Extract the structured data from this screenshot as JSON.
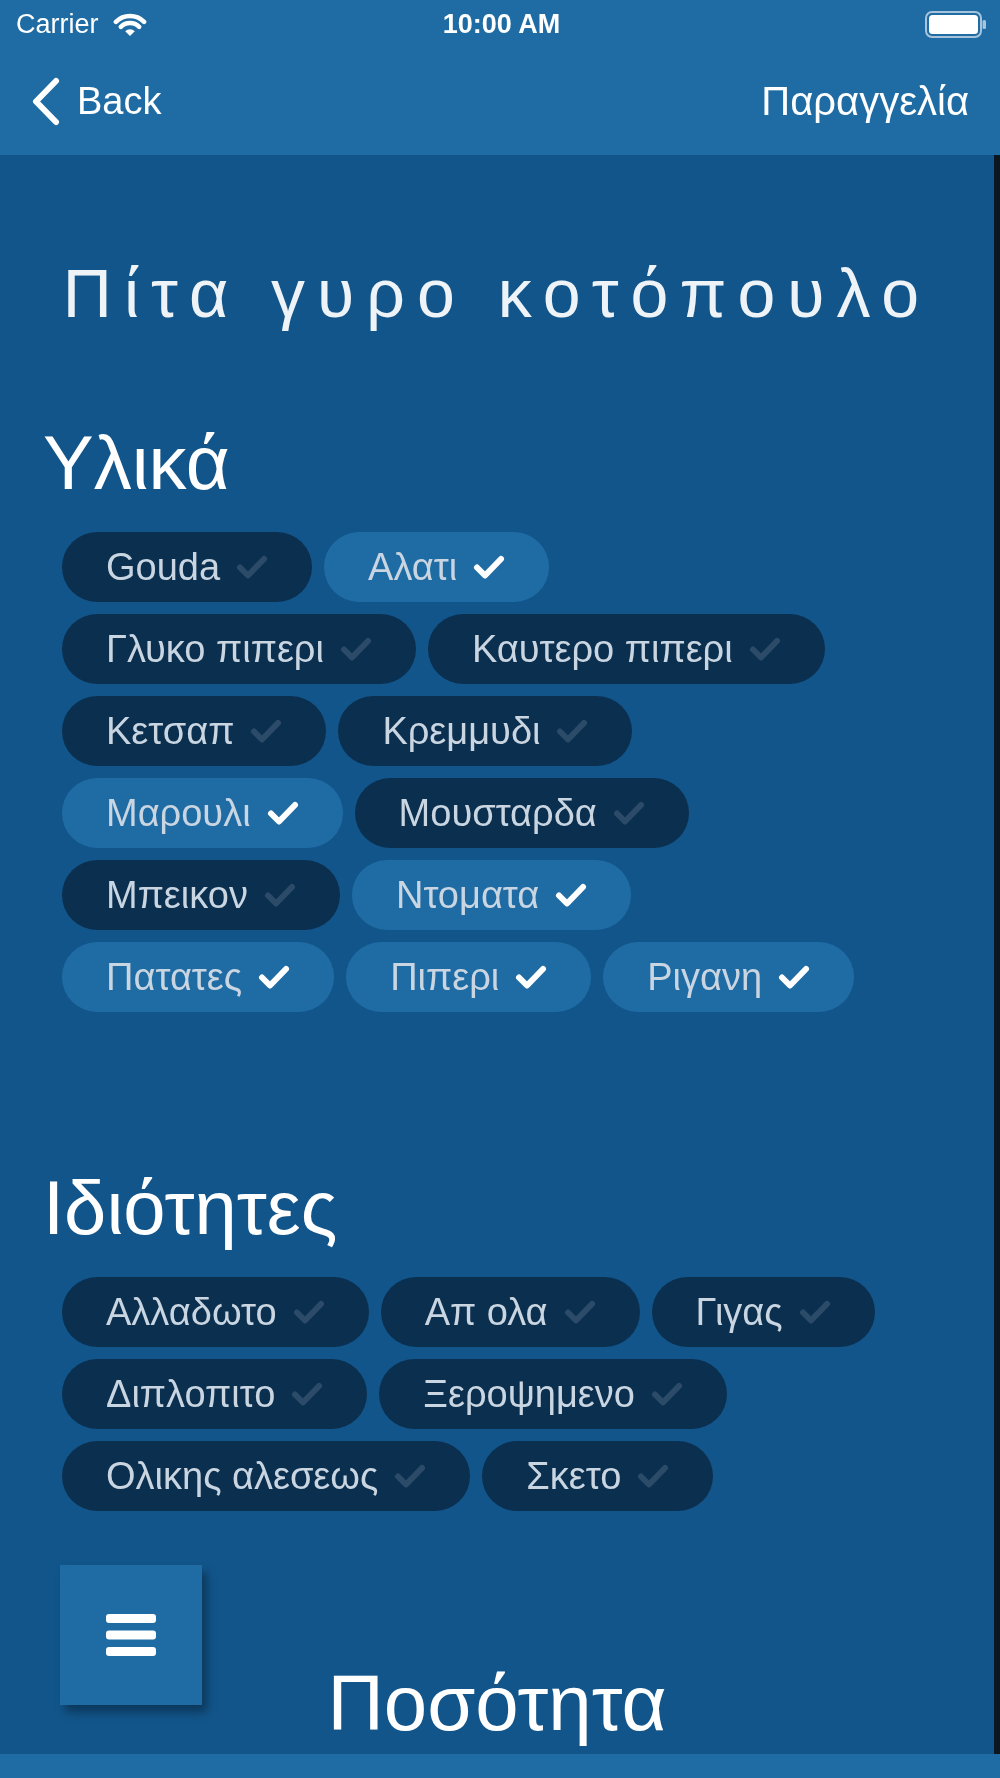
{
  "status_bar": {
    "carrier": "Carrier",
    "time": "10:00 AM"
  },
  "nav_bar": {
    "back_button": "Back",
    "right_button": "Παραγγελία"
  },
  "title": "Πίτα γυρο κοτόπουλο",
  "ingredients": {
    "heading": "Υλικά",
    "items": [
      {
        "label": "Gouda",
        "selected": false
      },
      {
        "label": "Αλατι",
        "selected": true
      },
      {
        "label": "Γλυκο πιπερι",
        "selected": false
      },
      {
        "label": "Καυτερο πιπερι",
        "selected": false
      },
      {
        "label": "Κετσαπ",
        "selected": false
      },
      {
        "label": "Κρεμμυδι",
        "selected": false
      },
      {
        "label": "Μαρουλι",
        "selected": true
      },
      {
        "label": "Μουσταρδα",
        "selected": false
      },
      {
        "label": "Μπεικον",
        "selected": false
      },
      {
        "label": "Ντοματα",
        "selected": true
      },
      {
        "label": "Πατατες",
        "selected": true
      },
      {
        "label": "Πιπερι",
        "selected": true
      },
      {
        "label": "Ριγανη",
        "selected": true
      }
    ]
  },
  "properties": {
    "heading": "Ιδιότητες",
    "items": [
      {
        "label": "Αλλαδωτο",
        "selected": false
      },
      {
        "label": "Απ ολα",
        "selected": false
      },
      {
        "label": "Γιγας",
        "selected": false
      },
      {
        "label": "Διπλοπιτο",
        "selected": false
      },
      {
        "label": "Ξεροψημενο",
        "selected": false
      },
      {
        "label": "Ολικης αλεσεως",
        "selected": false
      },
      {
        "label": "Σκετο",
        "selected": false
      }
    ]
  },
  "quantity": {
    "heading": "Ποσότητα"
  }
}
